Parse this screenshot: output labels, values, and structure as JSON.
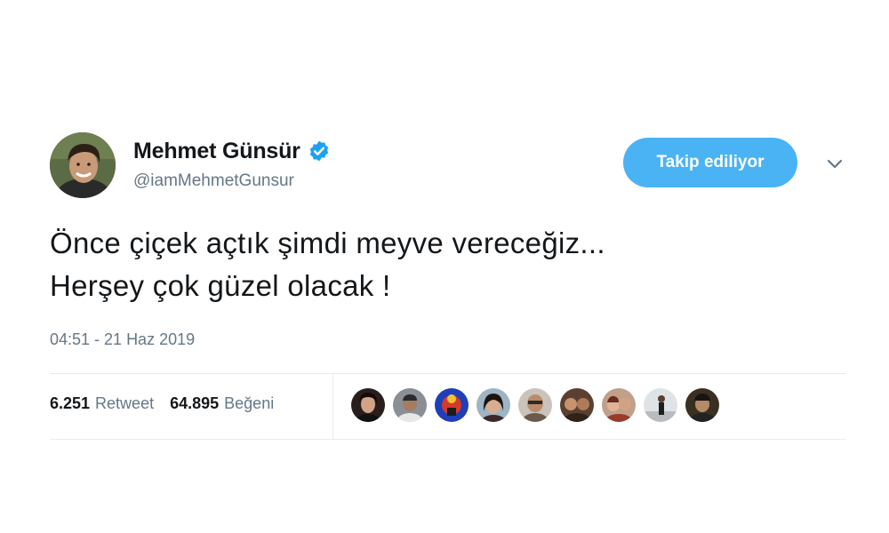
{
  "author": {
    "display_name": "Mehmet Günsür",
    "handle": "@iamMehmetGunsur",
    "verified": true
  },
  "follow_button": {
    "label": "Takip ediliyor"
  },
  "tweet": {
    "lines": [
      "Önce çiçek açtık şimdi meyve vereceğiz...",
      "Herşey çok güzel olacak !"
    ],
    "timestamp": "04:51 - 21 Haz 2019"
  },
  "stats": {
    "retweet_count": "6.251",
    "retweet_label": "Retweet",
    "like_count": "64.895",
    "like_label": "Beğeni"
  },
  "colors": {
    "accent": "#1da1f2",
    "follow_button_bg": "#4ab3f4",
    "secondary_text": "#657786",
    "primary_text": "#14171a",
    "divider": "#e6ecf0"
  },
  "icons": {
    "verified": "verified-badge-icon",
    "more": "chevron-down-icon"
  },
  "likers": [
    {
      "name": "liker-1"
    },
    {
      "name": "liker-2"
    },
    {
      "name": "liker-3"
    },
    {
      "name": "liker-4"
    },
    {
      "name": "liker-5"
    },
    {
      "name": "liker-6"
    },
    {
      "name": "liker-7"
    },
    {
      "name": "liker-8"
    },
    {
      "name": "liker-9"
    }
  ]
}
